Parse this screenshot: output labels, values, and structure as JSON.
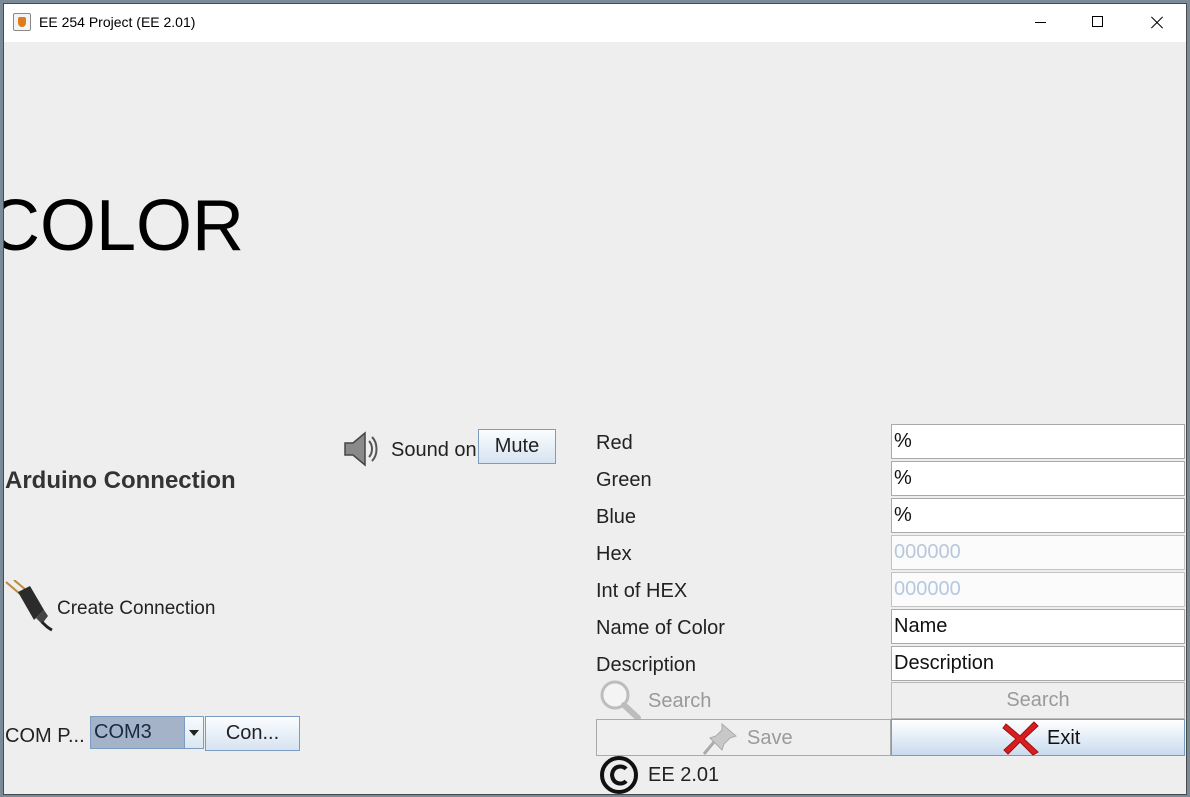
{
  "window": {
    "title": "EE 254 Project (EE 2.01)",
    "controls": [
      "minimize-icon",
      "maximize-icon",
      "close-icon"
    ]
  },
  "header": {
    "big_title": "COLOR"
  },
  "connection": {
    "heading": "Arduino Connection",
    "create_label": "Create Connection",
    "port_label": "COM P...",
    "port_selected": "COM3",
    "connect_button": "Con..."
  },
  "sound": {
    "status": "Sound on",
    "mute_button": "Mute"
  },
  "fields": {
    "red": {
      "label": "Red",
      "value": "%"
    },
    "green": {
      "label": "Green",
      "value": "%"
    },
    "blue": {
      "label": "Blue",
      "value": "%"
    },
    "hex": {
      "label": "Hex",
      "placeholder": "000000"
    },
    "int_hex": {
      "label": "Int of HEX",
      "placeholder": "000000"
    },
    "name": {
      "label": "Name of Color",
      "value": "Name"
    },
    "description": {
      "label": "Description",
      "value": "Description"
    }
  },
  "actions": {
    "search_label": "Search",
    "search_button": "Search",
    "save_button": "Save",
    "exit_button": "Exit"
  },
  "footer": {
    "version": "EE 2.01"
  },
  "colors": {
    "window_bg": "#eeeeee",
    "button_gradient_bottom": "#d6e3f1",
    "selected_combo_bg": "#a4b3c8",
    "exit_icon": "#d81e1e",
    "disabled_text": "#b5c9de"
  }
}
